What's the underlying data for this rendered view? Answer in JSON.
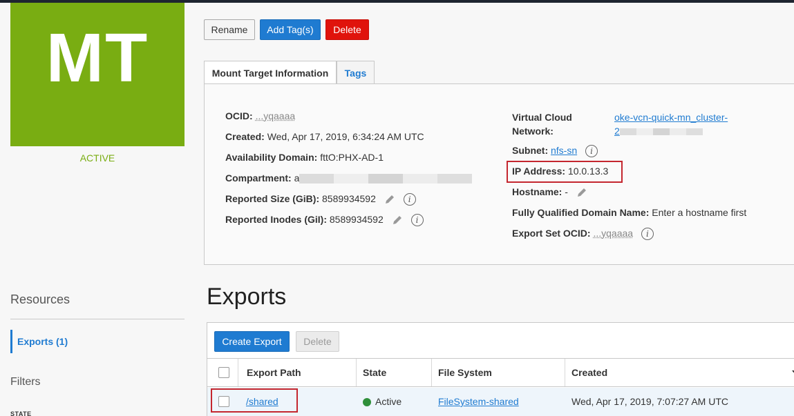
{
  "tile": {
    "initials": "MT",
    "state": "ACTIVE",
    "color": "#79ad12"
  },
  "toolbar": {
    "rename": "Rename",
    "add_tags": "Add Tag(s)",
    "delete": "Delete"
  },
  "tabs": [
    {
      "label": "Mount Target Information",
      "active": true
    },
    {
      "label": "Tags",
      "active": false
    }
  ],
  "info": {
    "ocid": {
      "label": "OCID:",
      "value": "...yqaaaa"
    },
    "created": {
      "label": "Created:",
      "value": "Wed, Apr 17, 2019, 6:34:24 AM UTC"
    },
    "ad": {
      "label": "Availability Domain:",
      "value": "fttO:PHX-AD-1"
    },
    "compartment": {
      "label": "Compartment:",
      "value": "a"
    },
    "reported_size": {
      "label": "Reported Size (GiB):",
      "value": "8589934592"
    },
    "reported_inodes": {
      "label": "Reported Inodes (GiI):",
      "value": "8589934592"
    },
    "vcn": {
      "label_line1": "Virtual Cloud",
      "label_line2": "Network:",
      "value_line1": "oke-vcn-quick-mn_cluster-",
      "value_line2": "2"
    },
    "subnet": {
      "label": "Subnet:",
      "value": "nfs-sn"
    },
    "ip_address": {
      "label": "IP Address:",
      "value": "10.0.13.3"
    },
    "hostname": {
      "label": "Hostname:",
      "value": "-"
    },
    "fqdn": {
      "label": "Fully Qualified Domain Name:",
      "value": "Enter a hostname first"
    },
    "export_set_ocid": {
      "label": "Export Set OCID:",
      "value": "...yqaaaa"
    }
  },
  "sidebar": {
    "resources_title": "Resources",
    "items": [
      {
        "label": "Exports (1)",
        "active": true
      }
    ],
    "filters_title": "Filters",
    "state_caption": "STATE"
  },
  "exports": {
    "title": "Exports",
    "create_button": "Create Export",
    "delete_button": "Delete",
    "columns": [
      "Export Path",
      "State",
      "File System",
      "Created"
    ],
    "rows": [
      {
        "export_path": "/shared",
        "state": "Active",
        "file_system": "FileSystem-shared",
        "created": "Wed, Apr 17, 2019, 7:07:27 AM UTC"
      }
    ]
  },
  "colors": {
    "accent": "#1f7bd1",
    "danger": "#e0130c",
    "active_green": "#2f8f3a",
    "highlight_red": "#c4262e"
  }
}
